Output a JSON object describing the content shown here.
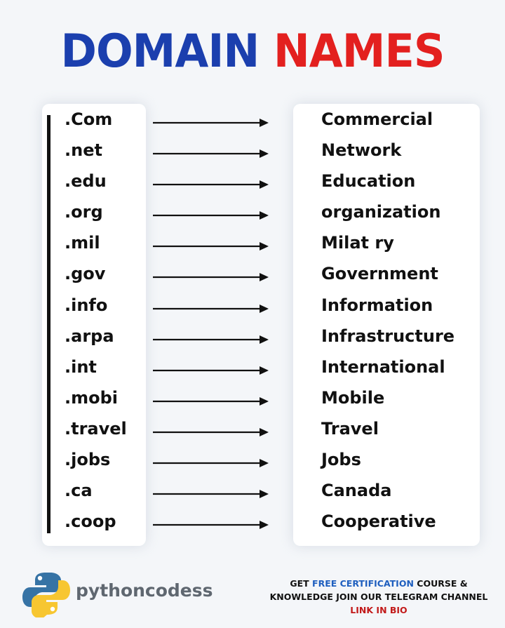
{
  "title": {
    "word1": "DOMAIN",
    "word2": "NAMES"
  },
  "rows": [
    {
      "ext": ".Com",
      "meaning": "Commercial"
    },
    {
      "ext": ".net",
      "meaning": "Network"
    },
    {
      "ext": ".edu",
      "meaning": "Education"
    },
    {
      "ext": ".org",
      "meaning": "organization"
    },
    {
      "ext": ".mil",
      "meaning": "Milat ry"
    },
    {
      "ext": ".gov",
      "meaning": "Government"
    },
    {
      "ext": ".info",
      "meaning": "Information"
    },
    {
      "ext": ".arpa",
      "meaning": "Infrastructure"
    },
    {
      "ext": ".int",
      "meaning": "International"
    },
    {
      "ext": ".mobi",
      "meaning": "Mobile"
    },
    {
      "ext": ".travel",
      "meaning": "Travel"
    },
    {
      "ext": ".jobs",
      "meaning": "Jobs"
    },
    {
      "ext": ".ca",
      "meaning": "Canada"
    },
    {
      "ext": ".coop",
      "meaning": "Cooperative"
    }
  ],
  "footer": {
    "brand": "pythoncodess",
    "logo_icon": "python-logo-icon",
    "promo_part1": "GET ",
    "promo_highlight": "FREE CERTIFICATION",
    "promo_part2": " COURSE &",
    "promo_line2": "KNOWLEDGE JOIN OUR TELEGRAM CHANNEL",
    "promo_link": "LINK IN BIO"
  },
  "colors": {
    "title_blue": "#1b3fae",
    "title_red": "#e3201f",
    "highlight_blue": "#1f5fbf",
    "link_red": "#c21a1a"
  }
}
